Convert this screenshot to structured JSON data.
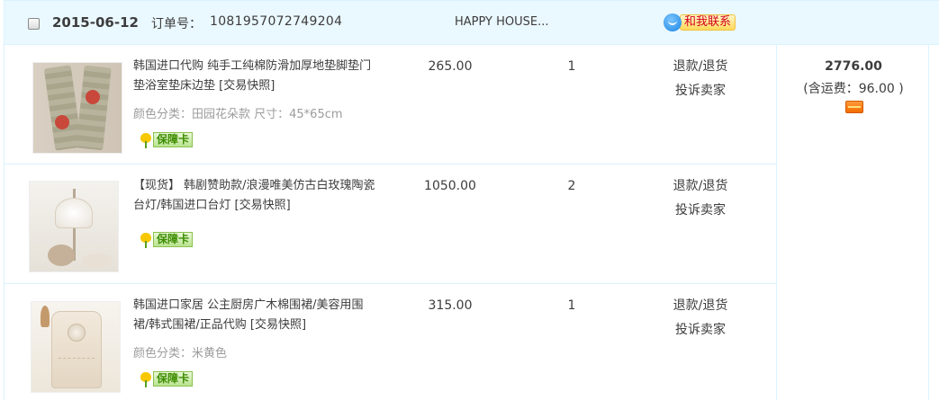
{
  "order": {
    "date": "2015-06-12",
    "order_no_label": "订单号：",
    "order_no": "1081957072749204",
    "shop_name": "HAPPY HOUSE...",
    "contact_label": "和我联系",
    "total": "2776.00",
    "shipping": "(含运费：96.00 )"
  },
  "items": [
    {
      "title": "韩国进口代购 纯手工纯棉防滑加厚地垫脚垫门垫浴室垫床边垫 [交易快照]",
      "sku": "颜色分类：田园花朵款  尺寸：45*65cm",
      "badge": "保障卡",
      "price": "265.00",
      "qty": "1",
      "refund": "退款/退货",
      "complain": "投诉卖家"
    },
    {
      "title": "【现货】 韩剧赞助款/浪漫唯美仿古白玫瑰陶瓷台灯/韩国进口台灯 [交易快照]",
      "badge": "保障卡",
      "price": "1050.00",
      "qty": "2",
      "refund": "退款/退货",
      "complain": "投诉卖家"
    },
    {
      "title": "韩国进口家居 公主厨房广木棉围裙/美容用围裙/韩式围裙/正品代购 [交易快照]",
      "sku": "颜色分类：米黄色",
      "badge": "保障卡",
      "price": "315.00",
      "qty": "1",
      "refund": "退款/退货",
      "complain": "投诉卖家"
    }
  ],
  "icons": {
    "contact": "chat-bubble-icon",
    "badge": "flower-icon",
    "payment": "card-icon"
  }
}
